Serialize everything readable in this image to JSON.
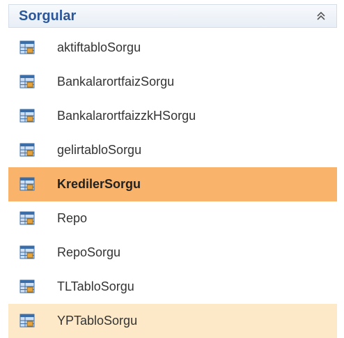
{
  "panel": {
    "title": "Sorgular",
    "collapse_icon": "chevron-double-up-icon"
  },
  "items": [
    {
      "label": "aktiftabloSorgu",
      "state": "normal"
    },
    {
      "label": "BankalarortfaizSorgu",
      "state": "normal"
    },
    {
      "label": "BankalarortfaizzkHSorgu",
      "state": "normal"
    },
    {
      "label": "gelirtabloSorgu",
      "state": "normal"
    },
    {
      "label": "KredilerSorgu",
      "state": "selected"
    },
    {
      "label": "Repo",
      "state": "normal"
    },
    {
      "label": "RepoSorgu",
      "state": "normal"
    },
    {
      "label": "TLTabloSorgu",
      "state": "normal"
    },
    {
      "label": "YPTabloSorgu",
      "state": "hover"
    }
  ],
  "item_icon": "query-icon",
  "colors": {
    "header_text": "#2b579a",
    "selected_bg": "#f9b36b",
    "hover_bg": "#fde9c8"
  }
}
